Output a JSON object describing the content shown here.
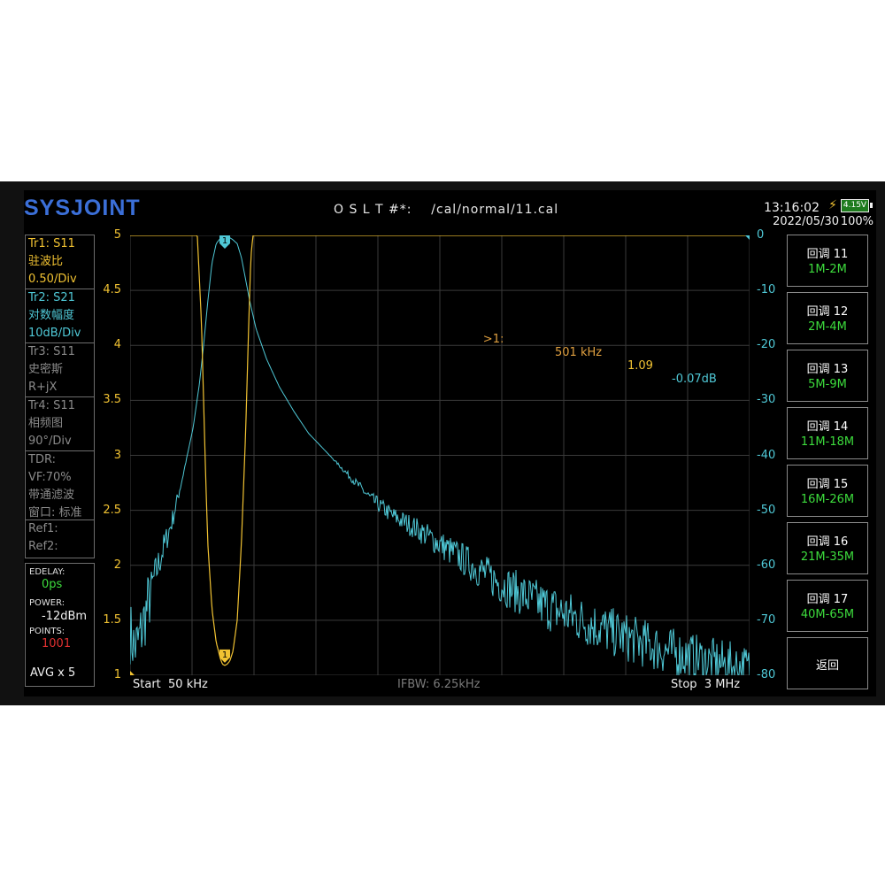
{
  "header": {
    "logo": "SYSJOINT",
    "cal_file": "O S L T #*:    /cal/normal/11.cal",
    "time": "13:16:02",
    "date": "2022/05/30",
    "battery_voltage": "4.15V",
    "battery_percent": "100%"
  },
  "traces": [
    {
      "lines": [
        "Tr1:   S11",
        "驻波比",
        "0.50/Div"
      ],
      "color": "#f1c232"
    },
    {
      "lines": [
        "Tr2:   S21",
        "对数幅度",
        "10dB/Div"
      ],
      "color": "#4fc8d6"
    },
    {
      "lines": [
        "Tr3:   S11",
        "史密斯",
        "R+jX"
      ],
      "color": "#8a8a8a"
    },
    {
      "lines": [
        "Tr4:   S11",
        "相频图",
        "90°/Div"
      ],
      "color": "#8a8a8a"
    },
    {
      "lines": [
        "TDR:",
        "VF:70%",
        "带通滤波",
        "窗口: 标准"
      ],
      "color": "#8a8a8a"
    },
    {
      "lines": [
        "Ref1:",
        "Ref2:"
      ],
      "color": "#8a8a8a"
    }
  ],
  "settings": {
    "edelay_label": "EDELAY:",
    "edelay_value": "0ps",
    "power_label": "POWER:",
    "power_value": "-12dBm",
    "points_label": "POINTS:",
    "points_value": "1001",
    "avg": "AVG x 5"
  },
  "marker": {
    "label": ">1:",
    "freq": "501 kHz",
    "swr": "1.09",
    "db": "-0.07dB",
    "number": "1"
  },
  "chart_data": {
    "type": "line",
    "x_start": "Start  50 kHz",
    "x_stop": "Stop  3 MHz",
    "ifbw": "IFBW: 6.25kHz",
    "xlim_khz": [
      50,
      3000
    ],
    "left_axis": {
      "ticks": [
        "5",
        "4.5",
        "4",
        "3.5",
        "3",
        "2.5",
        "2",
        "1.5",
        "1"
      ],
      "ylim": [
        1,
        5
      ]
    },
    "right_axis": {
      "ticks": [
        "0",
        "-10",
        "-20",
        "-30",
        "-40",
        "-50",
        "-60",
        "-70",
        "-80"
      ],
      "ylim": [
        -80,
        0
      ]
    },
    "series": [
      {
        "color": "#f1c232",
        "x_khz": [
          50,
          330,
          370,
          390,
          400,
          410,
          420,
          440,
          460,
          480,
          490,
          501,
          512,
          525,
          540,
          560,
          580,
          600,
          615,
          625,
          635,
          650,
          680,
          3000
        ],
        "y": [
          5,
          5,
          5,
          4.2,
          3.5,
          2.8,
          2.2,
          1.6,
          1.3,
          1.15,
          1.1,
          1.09,
          1.1,
          1.13,
          1.22,
          1.5,
          2.2,
          3.2,
          4.2,
          4.8,
          5,
          5,
          5,
          5
        ]
      },
      {
        "color": "#4fc8d6",
        "x_khz": [
          50,
          70,
          90,
          110,
          130,
          160,
          200,
          250,
          300,
          350,
          380,
          400,
          420,
          440,
          460,
          480,
          501,
          520,
          540,
          560,
          580,
          600,
          620,
          650,
          700,
          760,
          830,
          900,
          1000,
          1100,
          1200,
          1300,
          1400,
          1500,
          1600,
          1700,
          1800,
          1900,
          2000,
          2200,
          2400,
          2600,
          2800,
          3000
        ],
        "y": [
          -72,
          -75,
          -74,
          -71,
          -68,
          -63,
          -58,
          -52,
          -44,
          -35,
          -27,
          -20,
          -12,
          -5,
          -1.5,
          -0.5,
          -0.07,
          -0.3,
          -0.8,
          -1.5,
          -4,
          -8,
          -12,
          -17,
          -22.5,
          -27.5,
          -32,
          -36,
          -40,
          -44,
          -48,
          -51,
          -53,
          -55.5,
          -58,
          -60.5,
          -63,
          -65,
          -67,
          -70,
          -73,
          -75.5,
          -77.5,
          -79
        ]
      }
    ]
  },
  "softkeys": [
    {
      "title": "回调 11",
      "range": "1M-2M"
    },
    {
      "title": "回调 12",
      "range": "2M-4M"
    },
    {
      "title": "回调 13",
      "range": "5M-9M"
    },
    {
      "title": "回调 14",
      "range": "11M-18M"
    },
    {
      "title": "回调 15",
      "range": "16M-26M"
    },
    {
      "title": "回调 16",
      "range": "21M-35M"
    },
    {
      "title": "回调 17",
      "range": "40M-65M"
    },
    {
      "title": "返回",
      "range": ""
    }
  ]
}
